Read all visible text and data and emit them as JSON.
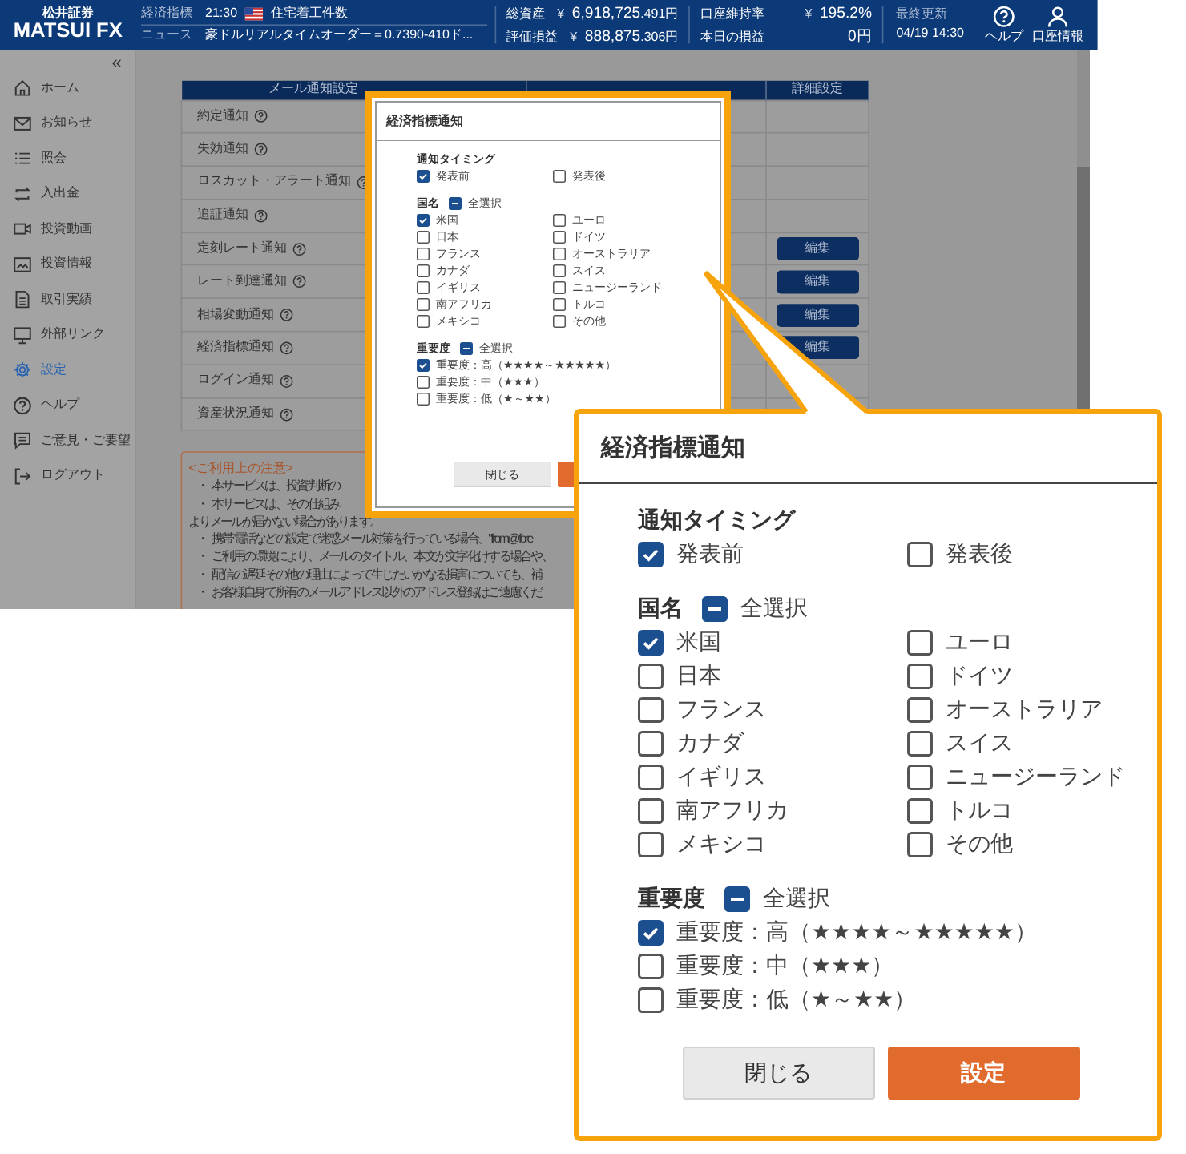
{
  "header": {
    "logo_caption": "松井証券",
    "logo": "MATSUI FX",
    "ticker": [
      {
        "kind": "indicator",
        "label": "経済指標",
        "time": "21:30",
        "text": "住宅着工件数"
      },
      {
        "kind": "news",
        "label": "ニュース",
        "text": "豪ドルリアルタイムオーダー＝0.7390-410ド..."
      }
    ],
    "balances": [
      [
        {
          "label": "総資産",
          "currency": "¥",
          "value": "6,918,725",
          "fraction": ".491円"
        },
        {
          "label": "評価損益",
          "currency": "¥",
          "value": "888,875",
          "fraction": ".306円"
        }
      ],
      [
        {
          "label": "口座維持率",
          "currency": "¥",
          "value": "195.2%"
        },
        {
          "label": "本日の損益",
          "value": "0円"
        }
      ]
    ],
    "last_update": {
      "label": "最終更新",
      "value": "04/19 14:30"
    },
    "actions": [
      {
        "label": "ヘルプ"
      },
      {
        "label": "口座情報"
      }
    ]
  },
  "sidebar": {
    "collapse": "«",
    "items": [
      {
        "label": "ホーム",
        "selected": false
      },
      {
        "label": "お知らせ",
        "selected": false
      },
      {
        "label": "照会",
        "selected": false
      },
      {
        "label": "入出金",
        "selected": false
      },
      {
        "label": "投資動画",
        "selected": false
      },
      {
        "label": "投資情報",
        "selected": false
      },
      {
        "label": "取引実績",
        "selected": false
      },
      {
        "label": "外部リンク",
        "selected": false
      },
      {
        "label": "設定",
        "selected": true
      },
      {
        "label": "ヘルプ",
        "selected": false
      },
      {
        "label": "ご意見・ご要望",
        "selected": false
      },
      {
        "label": "ログアウト",
        "selected": false
      }
    ]
  },
  "table": {
    "header": {
      "name": "メール通知設定",
      "detail": "詳細設定"
    },
    "rows": [
      {
        "name": "約定通知"
      },
      {
        "name": "失効通知"
      },
      {
        "name": "ロスカット・アラート通知"
      },
      {
        "name": "追証通知"
      },
      {
        "name": "定刻レート通知",
        "action": "編集"
      },
      {
        "name": "レート到達通知",
        "action": "編集"
      },
      {
        "name": "相場変動通知",
        "action": "編集"
      },
      {
        "name": "経済指標通知",
        "action": "編集"
      },
      {
        "name": "ログイン通知"
      },
      {
        "name": "資産状況通知"
      }
    ]
  },
  "notice": {
    "title": "<ご利用上の注意>",
    "lines": [
      {
        "kind": "bullet",
        "bullet": "・",
        "text": "本サービスは、投資判断の"
      },
      {
        "kind": "bullet",
        "bullet": "・",
        "text": "本サービスは、その仕組み"
      },
      {
        "kind": "continuation",
        "text": "よりメールが届かない場合があります。"
      },
      {
        "kind": "bullet",
        "bullet": "・",
        "text": "携帯電話などの設定で迷惑メール対策を行っている場合、\"from@fore"
      },
      {
        "kind": "bullet",
        "bullet": "・",
        "text": "ご利用の環境により、メールのタイトル、本文が文字化けする場合や、"
      },
      {
        "kind": "bullet",
        "bullet": "・",
        "text": "配信の遅延その他の理由によって生じたいかなる損害についても、補"
      },
      {
        "kind": "bullet",
        "bullet": "・",
        "text": "お客様自身で所有のメールアドレス以外のアドレス登録はご遠慮くだ"
      }
    ]
  },
  "small_dialog": {
    "title": "経済指標通知",
    "sections": [
      {
        "label": "通知タイミング",
        "rows": [
          [
            {
              "label": "発表前",
              "checked": true
            },
            {
              "label": "発表後",
              "checked": false
            }
          ]
        ]
      },
      {
        "label": "国名",
        "select_all": {
          "label": "全選択",
          "indeterminate": true
        },
        "rows": [
          [
            {
              "label": "米国",
              "checked": true
            },
            {
              "label": "ユーロ",
              "checked": false
            }
          ],
          [
            {
              "label": "日本",
              "checked": false
            },
            {
              "label": "ドイツ",
              "checked": false
            }
          ],
          [
            {
              "label": "フランス",
              "checked": false
            },
            {
              "label": "オーストラリア",
              "checked": false
            }
          ],
          [
            {
              "label": "カナダ",
              "checked": false
            },
            {
              "label": "スイス",
              "checked": false
            }
          ],
          [
            {
              "label": "イギリス",
              "checked": false
            },
            {
              "label": "ニュージーランド",
              "checked": false
            }
          ],
          [
            {
              "label": "南アフリカ",
              "checked": false
            },
            {
              "label": "トルコ",
              "checked": false
            }
          ],
          [
            {
              "label": "メキシコ",
              "checked": false
            },
            {
              "label": "その他",
              "checked": false
            }
          ]
        ]
      },
      {
        "label": "重要度",
        "select_all": {
          "label": "全選択",
          "indeterminate": true
        },
        "rows": [
          [
            {
              "label": "重要度：高（★★★★～★★★★★）",
              "checked": true
            }
          ],
          [
            {
              "label": "重要度：中（★★★）",
              "checked": false
            }
          ],
          [
            {
              "label": "重要度：低（★～★★）",
              "checked": false
            }
          ]
        ]
      }
    ],
    "buttons": [
      {
        "label": "閉じる",
        "kind": "secondary"
      },
      {
        "kind": "primary"
      }
    ]
  },
  "zoom_callout": {
    "title": "経済指標通知",
    "sections": [
      {
        "label": "通知タイミング",
        "rows": [
          [
            {
              "label": "発表前",
              "checked": true
            },
            {
              "label": "発表後",
              "checked": false
            }
          ]
        ]
      },
      {
        "label": "国名",
        "select_all": {
          "label": "全選択",
          "indeterminate": true
        },
        "rows": [
          [
            {
              "label": "米国",
              "checked": true
            },
            {
              "label": "ユーロ",
              "checked": false
            }
          ],
          [
            {
              "label": "日本",
              "checked": false
            },
            {
              "label": "ドイツ",
              "checked": false
            }
          ],
          [
            {
              "label": "フランス",
              "checked": false
            },
            {
              "label": "オーストラリア",
              "checked": false
            }
          ],
          [
            {
              "label": "カナダ",
              "checked": false
            },
            {
              "label": "スイス",
              "checked": false
            }
          ],
          [
            {
              "label": "イギリス",
              "checked": false
            },
            {
              "label": "ニュージーランド",
              "checked": false
            }
          ],
          [
            {
              "label": "南アフリカ",
              "checked": false
            },
            {
              "label": "トルコ",
              "checked": false
            }
          ],
          [
            {
              "label": "メキシコ",
              "checked": false
            },
            {
              "label": "その他",
              "checked": false
            }
          ]
        ]
      },
      {
        "label": "重要度",
        "select_all": {
          "label": "全選択",
          "indeterminate": true
        },
        "rows": [
          [
            {
              "label": "重要度：高（★★★★～★★★★★）",
              "checked": true
            }
          ],
          [
            {
              "label": "重要度：中（★★★）",
              "checked": false
            }
          ],
          [
            {
              "label": "重要度：低（★～★★）",
              "checked": false
            }
          ]
        ]
      }
    ],
    "buttons": [
      {
        "label": "閉じる",
        "kind": "secondary"
      },
      {
        "label": "設定",
        "kind": "primary"
      }
    ]
  }
}
